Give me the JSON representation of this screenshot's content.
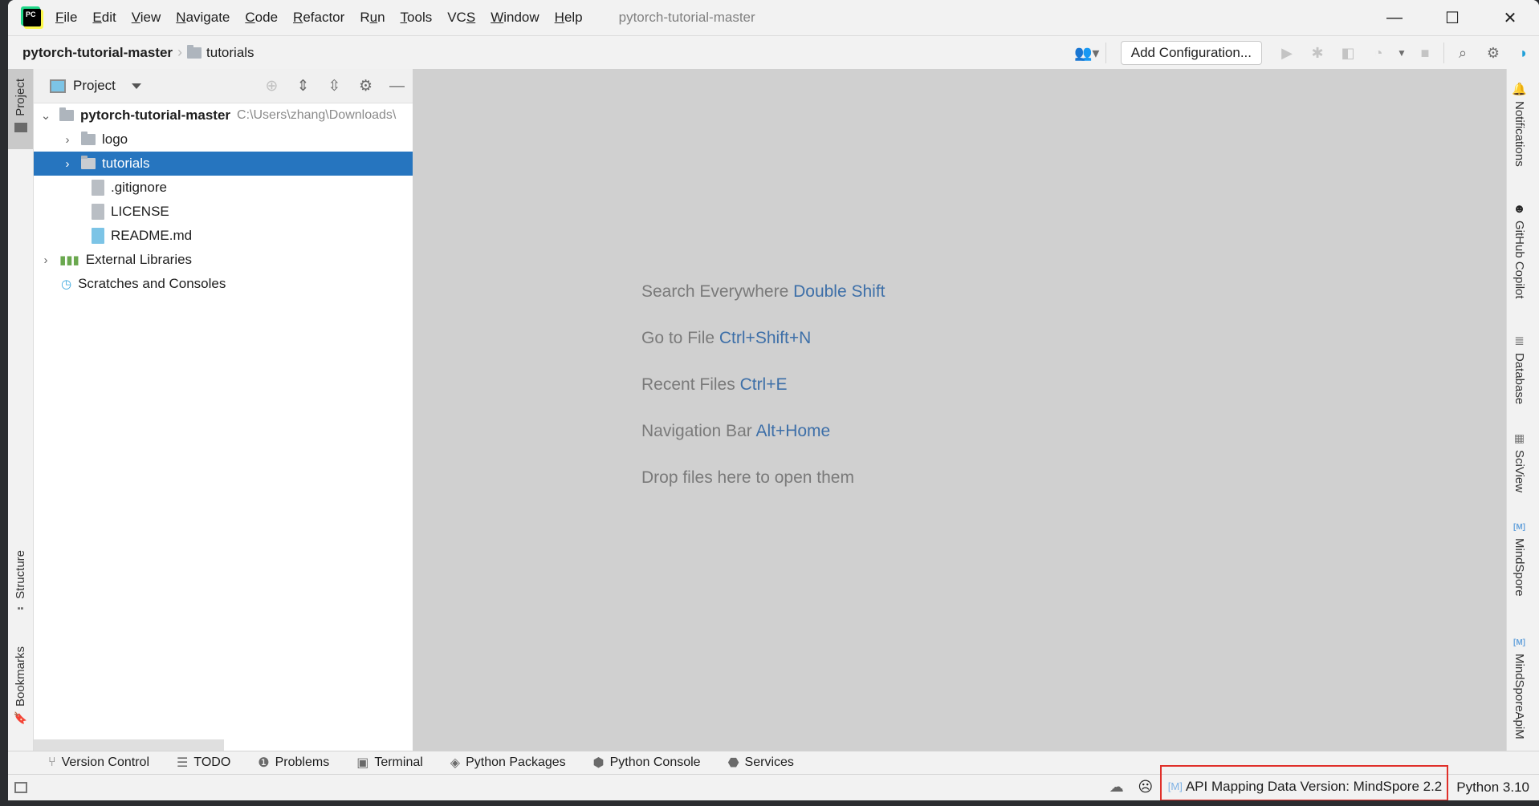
{
  "app": {
    "logo_text": "PC",
    "window_title": "pytorch-tutorial-master"
  },
  "menu": [
    "File",
    "Edit",
    "View",
    "Navigate",
    "Code",
    "Refactor",
    "Run",
    "Tools",
    "VCS",
    "Window",
    "Help"
  ],
  "menu_mnemonic_index": [
    0,
    0,
    0,
    0,
    0,
    0,
    1,
    0,
    2,
    0,
    0
  ],
  "window_controls": {
    "minimize": "—",
    "maximize": "☐",
    "close": "✕"
  },
  "breadcrumb": {
    "root": "pytorch-tutorial-master",
    "child": "tutorials"
  },
  "toolbar": {
    "add_configuration": "Add Configuration...",
    "icons": [
      "user-icon",
      "run-icon",
      "debug-icon",
      "coverage-icon",
      "profile-icon",
      "more-dropdown-icon",
      "stop-icon",
      "search-icon",
      "settings-icon",
      "code-with-me-icon"
    ]
  },
  "left_strip": {
    "project": "Project",
    "structure": "Structure",
    "bookmarks": "Bookmarks"
  },
  "project_panel": {
    "title": "Project",
    "tree": [
      {
        "label": "pytorch-tutorial-master",
        "path": "C:\\Users\\zhang\\Downloads\\",
        "type": "folder",
        "bold": true,
        "expanded": true,
        "level": 0
      },
      {
        "label": "logo",
        "type": "folder",
        "level": 1,
        "expanded": false
      },
      {
        "label": "tutorials",
        "type": "folder",
        "level": 1,
        "expanded": false,
        "selected": true
      },
      {
        "label": ".gitignore",
        "type": "gitignore",
        "level": 1
      },
      {
        "label": "LICENSE",
        "type": "text",
        "level": 1
      },
      {
        "label": "README.md",
        "type": "markdown",
        "level": 1
      },
      {
        "label": "External Libraries",
        "type": "libraries",
        "level": 0,
        "expanded": false
      },
      {
        "label": "Scratches and Consoles",
        "type": "scratches",
        "level": 0
      }
    ]
  },
  "editor_hints": [
    {
      "text": "Search Everywhere",
      "key": "Double Shift"
    },
    {
      "text": "Go to File",
      "key": "Ctrl+Shift+N"
    },
    {
      "text": "Recent Files",
      "key": "Ctrl+E"
    },
    {
      "text": "Navigation Bar",
      "key": "Alt+Home"
    },
    {
      "text": "Drop files here to open them",
      "key": ""
    }
  ],
  "right_strip": [
    "Notifications",
    "GitHub Copilot",
    "Database",
    "SciView",
    "MindSpore",
    "MindSporeApiM"
  ],
  "bottom_tools": [
    "Version Control",
    "TODO",
    "Problems",
    "Terminal",
    "Python Packages",
    "Python Console",
    "Services"
  ],
  "status_bar": {
    "api_mapping": "API Mapping Data Version: MindSpore 2.2",
    "interpreter": "Python 3.10",
    "highlight_color": "#e0302a"
  },
  "colors": {
    "selection": "#2675bf",
    "shortcut": "#3d6fa8",
    "editor_bg": "#d0d0d0"
  }
}
